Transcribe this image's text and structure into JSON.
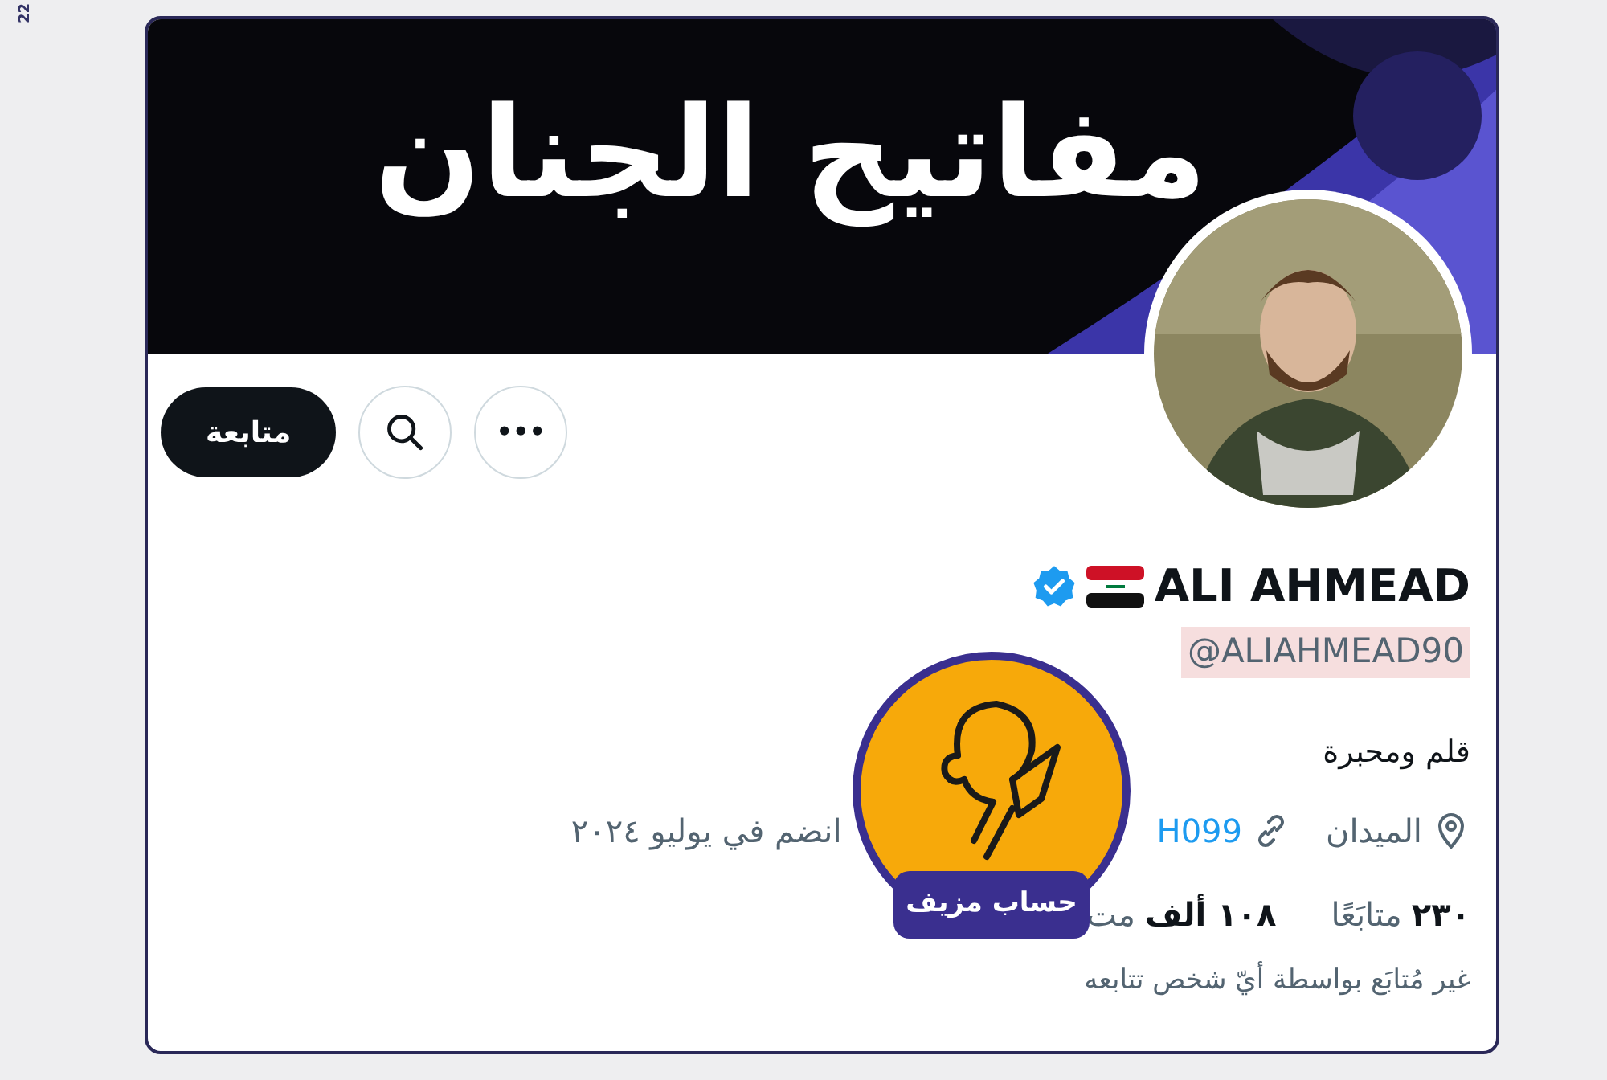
{
  "page_mark": "22",
  "banner": {
    "title": "مفاتيح الجنان"
  },
  "actions": {
    "more": "•••",
    "follow": "متابعة"
  },
  "profile": {
    "name": "ALI AHMEAD",
    "verified": true,
    "handle": "@ALIAHMEAD90",
    "bio": "قلم ومحبرة",
    "location": "الميدان",
    "link": "H099",
    "joined": "انضم في يوليو ٢٠٢٤",
    "following_count": "٢٣٠",
    "following_label": "متابَعًا",
    "followers_count": "١٠٨ ألف",
    "followers_label": "مت",
    "note": "غير مُتابَع بواسطة أيّ شخص تتابعه"
  },
  "stamp": {
    "label": "حساب مزيف"
  }
}
